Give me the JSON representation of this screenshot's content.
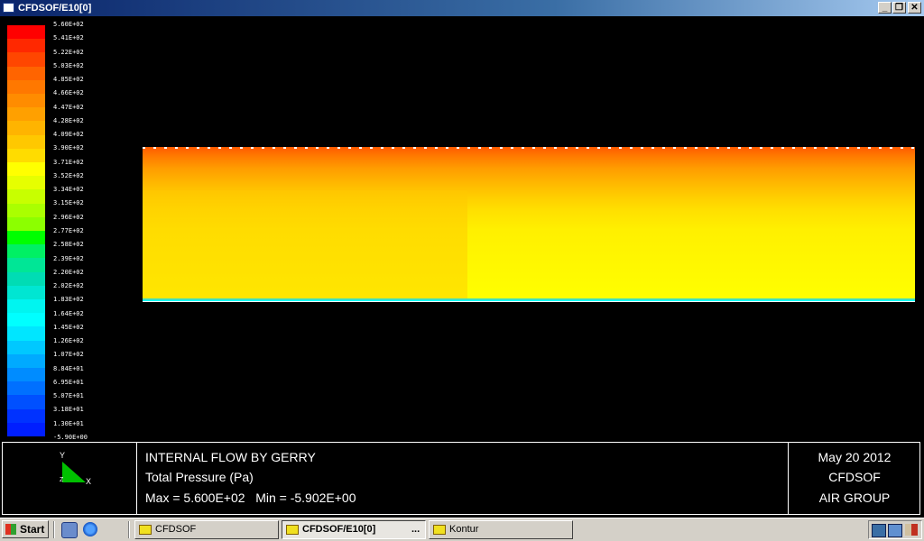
{
  "window": {
    "title": "CFDSOF/E10[0]",
    "buttons": [
      "_",
      "❐",
      "✕"
    ]
  },
  "legend": {
    "labels": [
      "5.60E+02",
      "5.41E+02",
      "5.22E+02",
      "5.03E+02",
      "4.85E+02",
      "4.66E+02",
      "4.47E+02",
      "4.28E+02",
      "4.09E+02",
      "3.90E+02",
      "3.71E+02",
      "3.52E+02",
      "3.34E+02",
      "3.15E+02",
      "2.96E+02",
      "2.77E+02",
      "2.58E+02",
      "2.39E+02",
      "2.20E+02",
      "2.02E+02",
      "1.83E+02",
      "1.64E+02",
      "1.45E+02",
      "1.26E+02",
      "1.07E+02",
      "8.84E+01",
      "6.95E+01",
      "5.07E+01",
      "3.18E+01",
      "1.30E+01",
      "-5.90E+00"
    ],
    "colors": [
      "#ff0000",
      "#ff2800",
      "#ff4600",
      "#ff6400",
      "#ff7800",
      "#ff8c00",
      "#ffa000",
      "#ffb400",
      "#ffc800",
      "#ffdc00",
      "#ffff00",
      "#e6ff00",
      "#c8ff00",
      "#aaff00",
      "#8cff00",
      "#00ff00",
      "#00f064",
      "#00e696",
      "#00dcb4",
      "#00e6d2",
      "#00f5f0",
      "#00ffff",
      "#00e6ff",
      "#00c8ff",
      "#00aaff",
      "#008cff",
      "#0070ff",
      "#0050ff",
      "#0032ff",
      "#001eff"
    ]
  },
  "info": {
    "axes": {
      "y": "Y",
      "x": "X",
      "z": "Z"
    },
    "line1": "INTERNAL FLOW BY GERRY",
    "line2": "Total Pressure (Pa)",
    "line3": "Max = 5.600E+02   Min = -5.902E+00",
    "date": "May 20 2012",
    "software": "CFDSOF",
    "group": "AIR GROUP"
  },
  "taskbar": {
    "start_label": "Start",
    "tasks": [
      {
        "label": "CFDSOF",
        "active": false
      },
      {
        "label": "CFDSOF/E10[0]",
        "active": true
      },
      {
        "label": "Kontur",
        "active": false
      }
    ],
    "active_ellipsis": "..."
  }
}
